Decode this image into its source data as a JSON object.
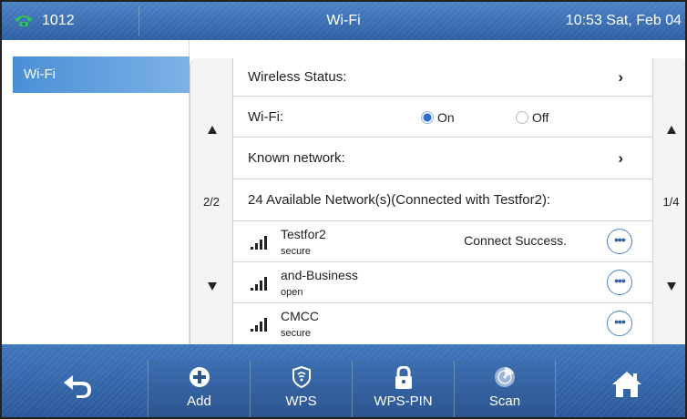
{
  "status_bar": {
    "extension": "1012",
    "title": "Wi-Fi",
    "clock": "10:53 Sat, Feb 04"
  },
  "menu": {
    "selected": "Wi-Fi"
  },
  "left_pager": {
    "page": "2/2"
  },
  "right_pager": {
    "page": "1/4"
  },
  "rows": {
    "wireless_status": "Wireless Status:",
    "wifi_label": "Wi-Fi:",
    "wifi_on": "On",
    "wifi_off": "Off",
    "wifi_value": "On",
    "known_network": "Known network:",
    "available_header": "24 Available Network(s)(Connected with Testfor2):"
  },
  "networks": [
    {
      "name": "Testfor2",
      "security": "secure",
      "status": "Connect Success."
    },
    {
      "name": "and-Business",
      "security": "open",
      "status": ""
    },
    {
      "name": "CMCC",
      "security": "secure",
      "status": ""
    }
  ],
  "more_label": "•••",
  "softkeys": {
    "add": "Add",
    "wps": "WPS",
    "wps_pin": "WPS-PIN",
    "scan": "Scan"
  },
  "colors": {
    "bar_blue": "#2f63a8",
    "selected_gradient_start": "#4a8fd6",
    "radio_on": "#2a6fd0",
    "phone_icon": "#2fbf5a"
  },
  "icons": {
    "phone": "phone-icon",
    "back": "back-arrow-icon",
    "home": "home-icon",
    "add": "plus-circle-icon",
    "wps": "shield-icon",
    "wps_pin": "lock-icon",
    "scan": "radar-icon",
    "signal": "wifi-signal-icon",
    "chevron": "chevron-right-icon"
  }
}
